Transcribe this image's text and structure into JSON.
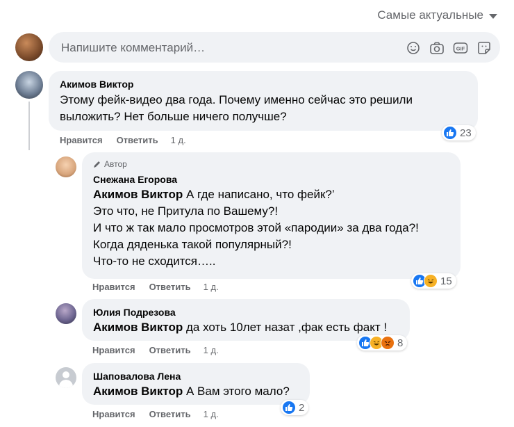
{
  "sort": {
    "label": "Самые актуальные"
  },
  "composer": {
    "placeholder": "Напишите комментарий…"
  },
  "comments": [
    {
      "author": "Акимов Виктор",
      "text": "Этому фейк-видео два года. Почему именно сейчас это решили выложить? Нет больше ничего получше?",
      "like_label": "Нравится",
      "reply_label": "Ответить",
      "time": "1 д.",
      "reaction_count": "23"
    },
    {
      "badge": "Автор",
      "author": "Снежана Егорова",
      "mention": "Акимов Виктор",
      "lines": [
        " А где написано, что фейк?’",
        "Это что, не Притула по Вашему?!",
        "И что ж так мало просмотров этой «пародии» за два года?!",
        "Когда дяденька такой популярный?!",
        "Что-то не сходится….."
      ],
      "like_label": "Нравится",
      "reply_label": "Ответить",
      "time": "1 д.",
      "reaction_count": "15"
    },
    {
      "author": "Юлия Подрезова",
      "mention": "Акимов Виктор",
      "text": " да хоть 10лет назат ,фак есть факт !",
      "like_label": "Нравится",
      "reply_label": "Ответить",
      "time": "1 д.",
      "reaction_count": "8"
    },
    {
      "author": "Шаповалова Лена",
      "mention": "Акимов Виктор",
      "text": " А Вам этого мало?",
      "like_label": "Нравится",
      "reply_label": "Ответить",
      "time": "1 д.",
      "reaction_count": "2"
    }
  ]
}
